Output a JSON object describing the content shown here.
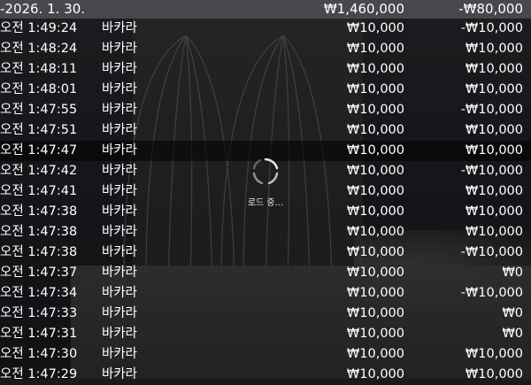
{
  "header": {
    "date": "-2026. 1. 30.",
    "total_bet": "₩1,460,000",
    "total_result": "-₩80,000"
  },
  "rows": [
    {
      "time": "오전 1:49:24",
      "game": "바카라",
      "bet": "₩10,000",
      "result": "-₩10,000"
    },
    {
      "time": "오전 1:48:24",
      "game": "바카라",
      "bet": "₩10,000",
      "result": "₩10,000"
    },
    {
      "time": "오전 1:48:11",
      "game": "바카라",
      "bet": "₩10,000",
      "result": "₩10,000"
    },
    {
      "time": "오전 1:48:01",
      "game": "바카라",
      "bet": "₩10,000",
      "result": "₩10,000"
    },
    {
      "time": "오전 1:47:55",
      "game": "바카라",
      "bet": "₩10,000",
      "result": "-₩10,000"
    },
    {
      "time": "오전 1:47:51",
      "game": "바카라",
      "bet": "₩10,000",
      "result": "₩10,000"
    },
    {
      "time": "오전 1:47:47",
      "game": "바카라",
      "bet": "₩10,000",
      "result": "₩10,000"
    },
    {
      "time": "오전 1:47:42",
      "game": "바카라",
      "bet": "₩10,000",
      "result": "-₩10,000"
    },
    {
      "time": "오전 1:47:41",
      "game": "바카라",
      "bet": "₩10,000",
      "result": "₩10,000"
    },
    {
      "time": "오전 1:47:38",
      "game": "바카라",
      "bet": "₩10,000",
      "result": "₩10,000"
    },
    {
      "time": "오전 1:47:38",
      "game": "바카라",
      "bet": "₩10,000",
      "result": "₩10,000"
    },
    {
      "time": "오전 1:47:38",
      "game": "바카라",
      "bet": "₩10,000",
      "result": "-₩10,000"
    },
    {
      "time": "오전 1:47:37",
      "game": "바카라",
      "bet": "₩10,000",
      "result": "₩0"
    },
    {
      "time": "오전 1:47:34",
      "game": "바카라",
      "bet": "₩10,000",
      "result": "-₩10,000"
    },
    {
      "time": "오전 1:47:33",
      "game": "바카라",
      "bet": "₩10,000",
      "result": "₩0"
    },
    {
      "time": "오전 1:47:31",
      "game": "바카라",
      "bet": "₩10,000",
      "result": "₩0"
    },
    {
      "time": "오전 1:47:30",
      "game": "바카라",
      "bet": "₩10,000",
      "result": "₩10,000"
    },
    {
      "time": "오전 1:47:29",
      "game": "바카라",
      "bet": "₩10,000",
      "result": "₩10,000"
    }
  ],
  "selected_row_index": 6,
  "loader": {
    "label": "로드 중...",
    "icon": "spinner-icon"
  },
  "colors": {
    "text": "#ffffff",
    "header_bg": "#6e6e73",
    "selected_bg": "#000000"
  }
}
